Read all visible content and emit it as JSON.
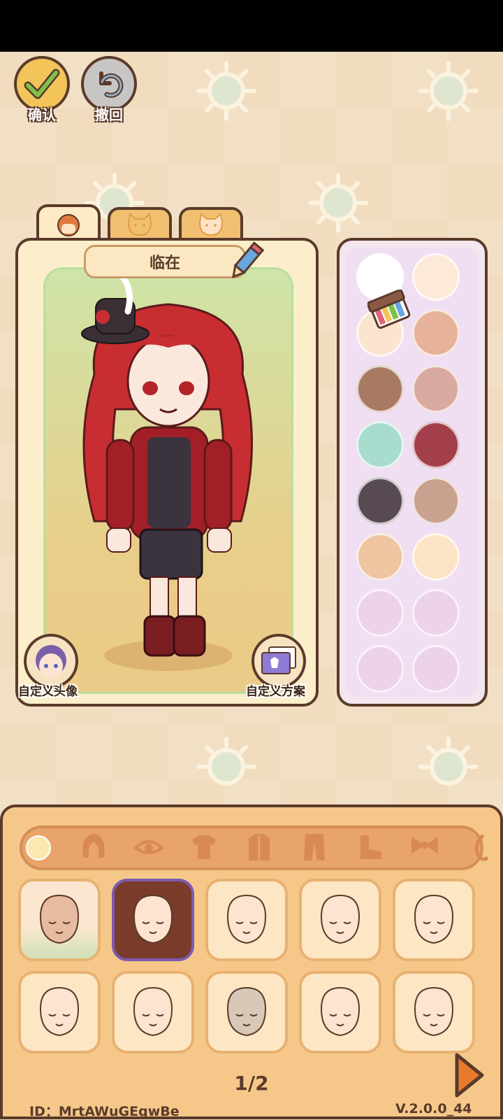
{
  "top_buttons": {
    "confirm_label": "确认",
    "undo_label": "撤回"
  },
  "character_tabs": [
    "person-tab",
    "cat-tab-1",
    "cat-tab-2"
  ],
  "character": {
    "name": "临在"
  },
  "preview_buttons": {
    "custom_avatar_label": "自定义头像",
    "custom_scheme_label": "自定义方案"
  },
  "palette": {
    "colors": [
      "#ffffff",
      "#fde9d8",
      "#fbe3cf",
      "#e7b29a",
      "#a87a63",
      "#d9aaa0",
      "#a8dccf",
      "#a33f4a",
      "#574a52",
      "#c9a18f",
      "#efc4a0",
      "#fde3c6",
      "#ecd3ea",
      "#ecd3ea",
      "#ecd3ea",
      "#ecd3ea"
    ]
  },
  "categories": [
    "face-icon",
    "hair-icon",
    "eye-icon",
    "shirt-icon",
    "coat-icon",
    "pants-icon",
    "shoe-icon",
    "bow-icon",
    "accessory-icon"
  ],
  "items": {
    "selected_index": 1
  },
  "pager": {
    "page": "1/2"
  },
  "footer": {
    "id_text": "ID：MrtAWuGEqwBe",
    "version": "V.2.0.0_44"
  },
  "colors": {
    "accent_orange": "#e8a46b",
    "outline_brown": "#5b3a2a",
    "selected_purple": "#7b5ab0"
  }
}
